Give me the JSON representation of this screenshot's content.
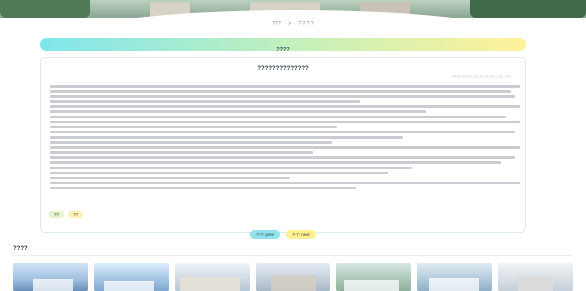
{
  "breadcrumb": {
    "home": "???",
    "sep": ">",
    "current": "? ? ? ?"
  },
  "notice": {
    "title": "????"
  },
  "article": {
    "title": "??????????????",
    "meta": "????: ????-??-?? ??:?? | ??: ???",
    "paragraph_line_counts": [
      4,
      2,
      3,
      2,
      3,
      3,
      2,
      2
    ]
  },
  "tags": [
    "??",
    "??"
  ],
  "pagination": {
    "prev": "?-?: prev",
    "next": "?-?: next"
  },
  "hot": {
    "title": "????"
  },
  "thumbnails": [
    "campus-building-1",
    "campus-building-2",
    "campus-building-3",
    "campus-building-4",
    "campus-building-5",
    "campus-building-6",
    "campus-building-7"
  ],
  "colors": {
    "bar_start": "#7fe6ee",
    "bar_mid": "#c7f0b9",
    "bar_end": "#fff29a",
    "tag_green": "#e3f4cc",
    "tag_yellow": "#fff0b3"
  }
}
